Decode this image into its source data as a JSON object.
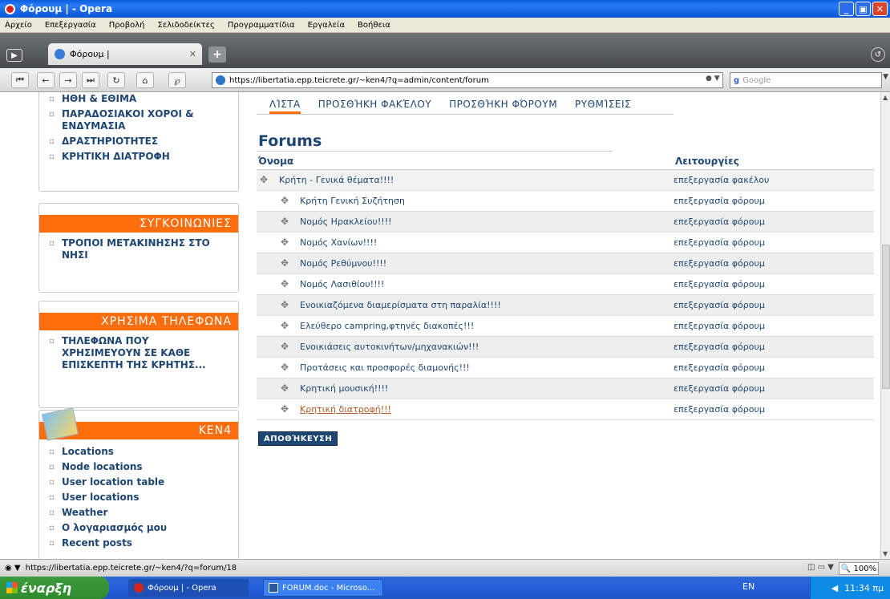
{
  "window": {
    "title": "Φόρουμ | - Opera"
  },
  "menu": [
    "Αρχείο",
    "Επεξεργασία",
    "Προβολή",
    "Σελιδοδείκτες",
    "Προγραμματίδια",
    "Εργαλεία",
    "Βοήθεια"
  ],
  "tab": {
    "label": "Φόρουμ |"
  },
  "address": {
    "url": "https://libertatia.epp.teicrete.gr/~ken4/?q=admin/content/forum",
    "search_placeholder": "Google"
  },
  "sidebar": {
    "top_items": [
      "ΗΘΗ & ΕΘΙΜΑ",
      "ΠΑΡΑΔΟΣΙΑΚΟΙ ΧΟΡΟΙ & ΕΝΔΥΜΑΣΙΑ",
      "ΔΡΑΣΤΗΡΙΟΤΗΤΕΣ",
      "ΚΡΗΤΙΚΗ ΔΙΑΤΡΟΦΗ"
    ],
    "transport": {
      "title": "ΣΥΓΚΟΙΝΩΝΙΕΣ",
      "items": [
        "ΤΡΟΠΟΙ ΜΕΤΑΚΙΝΗΣΗΣ ΣΤΟ ΝΗΣΙ"
      ]
    },
    "phones": {
      "title": "ΧΡΗΣΙΜΑ ΤΗΛΕΦΩΝΑ",
      "items": [
        "ΤΗΛΕΦΩΝΑ ΠΟΥ ΧΡΗΣΙΜΕΥΟΥΝ ΣΕ ΚΑΘΕ ΕΠΙΣΚΕΠΤΗ ΤΗΣ ΚΡΗΤΗΣ..."
      ]
    },
    "ken4": {
      "title": "KEN4",
      "items": [
        "Locations",
        "Node locations",
        "User location table",
        "User locations",
        "Weather",
        "Ο λογαριασμός μου",
        "Recent posts"
      ]
    }
  },
  "main": {
    "tabs": [
      "ΛΊΣΤΑ",
      "ΠΡΟΣΘΉΚΗ ΦΑΚΈΛΟΥ",
      "ΠΡΟΣΘΉΚΗ ΦΌΡΟΥΜ",
      "ΡΥΘΜΊΣΕΙΣ"
    ],
    "title": "Forums",
    "col_name": "Όνομα",
    "col_ops": "Λειτουργίες",
    "rows": [
      {
        "name": "Κρήτη - Γενικά θέματα!!!!",
        "op": "επεξεργασία φακέλου",
        "container": true
      },
      {
        "name": "Κρήτη Γενική Συζήτηση",
        "op": "επεξεργασία φόρουμ"
      },
      {
        "name": "Νομός Ηρακλείου!!!!",
        "op": "επεξεργασία φόρουμ"
      },
      {
        "name": "Νομός Χανίων!!!!",
        "op": "επεξεργασία φόρουμ"
      },
      {
        "name": "Νομός Ρεθύμνου!!!!",
        "op": "επεξεργασία φόρουμ"
      },
      {
        "name": "Νομός Λασιθίου!!!!",
        "op": "επεξεργασία φόρουμ"
      },
      {
        "name": "Ενοικιαζόμενα διαμερίσματα στη παραλία!!!!",
        "op": "επεξεργασία φόρουμ"
      },
      {
        "name": "Ελεύθερο campring,φτηνές διακοπές!!!",
        "op": "επεξεργασία φόρουμ"
      },
      {
        "name": "Ενοικιάσεις αυτοκινήτων/μηχανακιών!!!",
        "op": "επεξεργασία φόρουμ"
      },
      {
        "name": "Προτάσεις και προσφορές διαμονής!!!",
        "op": "επεξεργασία φόρουμ"
      },
      {
        "name": "Κρητική μουσική!!!!",
        "op": "επεξεργασία φόρουμ"
      },
      {
        "name": "Κρητική διατροφή!!!",
        "op": "επεξεργασία φόρουμ",
        "visited": true
      }
    ],
    "save_label": "ΑΠΟΘΉΚΕΥΣΗ"
  },
  "status": {
    "url": "https://libertatia.epp.teicrete.gr/~ken4/?q=forum/18",
    "zoom": "100%"
  },
  "taskbar": {
    "start": "έναρξη",
    "tasks": [
      "Φόρουμ | - Opera",
      "FORUM.doc - Microso..."
    ],
    "lang": "EN",
    "clock": "11:34 πμ"
  },
  "colors": {
    "accent": "#fe6d0c",
    "link": "#1d4672"
  }
}
